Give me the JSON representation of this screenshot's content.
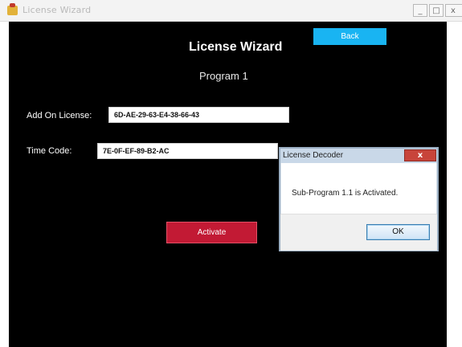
{
  "window": {
    "title": "License Wizard",
    "minimize_glyph": "_",
    "maximize_glyph": "□",
    "close_glyph": "x"
  },
  "main": {
    "heading": "License Wizard",
    "subheading": "Program 1",
    "back_label": "Back",
    "addon_label": "Add On License:",
    "addon_value": "6D-AE-29-63-E4-38-66-43",
    "timecode_label": "Time Code:",
    "timecode_value": "7E-0F-EF-89-B2-AC",
    "activate_label": "Activate"
  },
  "dialog": {
    "title": "License Decoder",
    "close_glyph": "x",
    "message": "Sub-Program 1.1 is Activated.",
    "ok_label": "OK"
  },
  "colors": {
    "background": "#000000",
    "back_button": "#19b4f2",
    "activate_button": "#c21a34"
  }
}
